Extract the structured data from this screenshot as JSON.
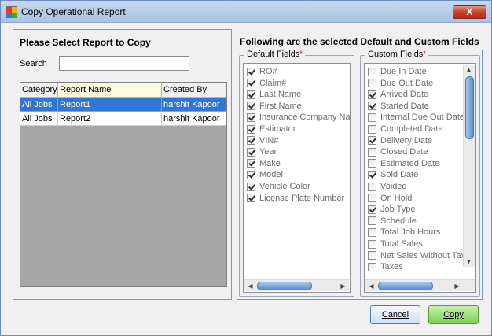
{
  "window": {
    "title": "Copy Operational Report",
    "close_label": "X"
  },
  "left": {
    "heading": "Please Select Report to Copy",
    "search_label": "Search",
    "search_value": "",
    "columns": [
      "Category",
      "Report Name",
      "Created By"
    ],
    "rows": [
      {
        "category": "All Jobs",
        "name": "Report1",
        "created_by": "harshit Kapoor",
        "selected": true
      },
      {
        "category": "All Jobs",
        "name": "Report2",
        "created_by": "harshit Kapoor",
        "selected": false
      }
    ]
  },
  "right": {
    "heading": "Following are the selected Default and Custom Fields",
    "default_title": "Default Fields",
    "custom_title": "Custom Fields",
    "required_mark": "*",
    "default_fields": [
      {
        "label": "RO#",
        "checked": true
      },
      {
        "label": "Claim#",
        "checked": true
      },
      {
        "label": "Last Name",
        "checked": true
      },
      {
        "label": "First Name",
        "checked": true
      },
      {
        "label": "Insurance Company Nam",
        "checked": true
      },
      {
        "label": "Estimator",
        "checked": true
      },
      {
        "label": "VIN#",
        "checked": true
      },
      {
        "label": "Year",
        "checked": true
      },
      {
        "label": "Make",
        "checked": true
      },
      {
        "label": "Model",
        "checked": true
      },
      {
        "label": "Vehicle Color",
        "checked": true
      },
      {
        "label": "License Plate Number",
        "checked": true
      }
    ],
    "custom_fields": [
      {
        "label": "Due In Date",
        "checked": false
      },
      {
        "label": "Due Out Date",
        "checked": false
      },
      {
        "label": "Arrived Date",
        "checked": true
      },
      {
        "label": "Started Date",
        "checked": true
      },
      {
        "label": "Internal Due Out Date",
        "checked": false
      },
      {
        "label": "Completed Date",
        "checked": false
      },
      {
        "label": "Delivery Date",
        "checked": true
      },
      {
        "label": "Closed Date",
        "checked": false
      },
      {
        "label": "Estimated Date",
        "checked": false
      },
      {
        "label": "Sold Date",
        "checked": true
      },
      {
        "label": "Voided",
        "checked": false
      },
      {
        "label": "On Hold",
        "checked": false
      },
      {
        "label": "Job Type",
        "checked": true
      },
      {
        "label": "Schedule",
        "checked": false
      },
      {
        "label": "Total Job Hours",
        "checked": false
      },
      {
        "label": "Total Sales",
        "checked": false
      },
      {
        "label": "Net Sales Without Taxes",
        "checked": false
      },
      {
        "label": "Taxes",
        "checked": false
      }
    ]
  },
  "buttons": {
    "cancel": "Cancel",
    "copy": "Copy"
  }
}
